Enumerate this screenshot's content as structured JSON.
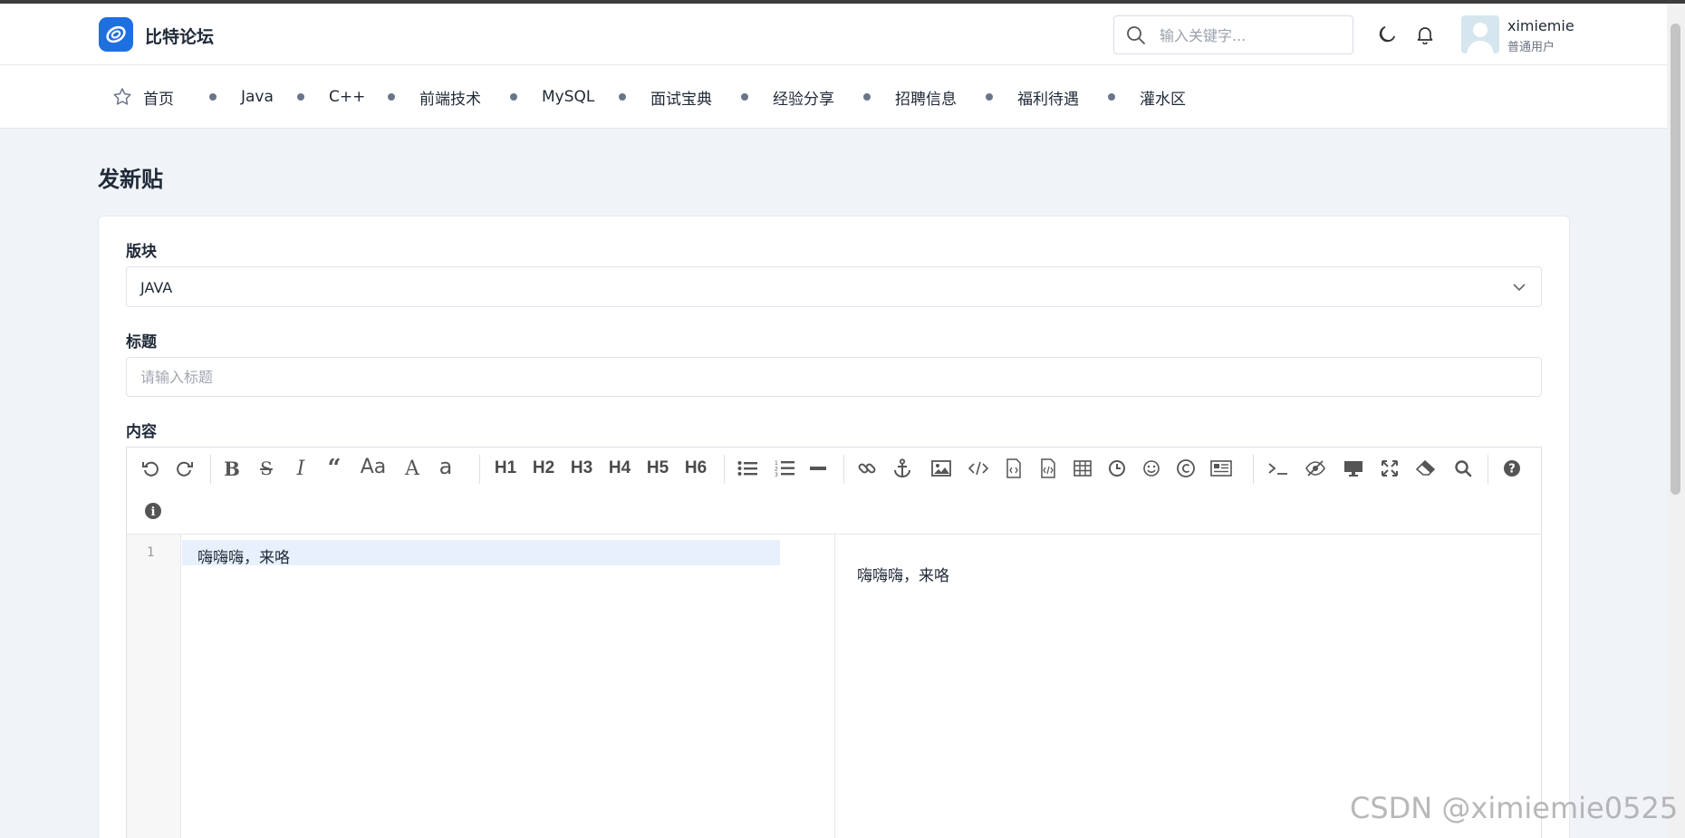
{
  "header": {
    "brand": "比特论坛",
    "search_placeholder": "输入关键字...",
    "user_name": "ximiemie",
    "user_role": "普通用户"
  },
  "nav": {
    "items": [
      {
        "label": "首页",
        "icon": "star-icon"
      },
      {
        "label": "Java"
      },
      {
        "label": "C++"
      },
      {
        "label": "前端技术"
      },
      {
        "label": "MySQL"
      },
      {
        "label": "面试宝典"
      },
      {
        "label": "经验分享"
      },
      {
        "label": "招聘信息"
      },
      {
        "label": "福利待遇"
      },
      {
        "label": "灌水区"
      }
    ]
  },
  "page": {
    "title": "发新贴"
  },
  "form": {
    "section_label": "版块",
    "section_value": "JAVA",
    "title_label": "标题",
    "title_placeholder": "请输入标题",
    "content_label": "内容"
  },
  "editor": {
    "headings": [
      "H1",
      "H2",
      "H3",
      "H4",
      "H5",
      "H6"
    ],
    "line_number": "1",
    "content": "嗨嗨嗨，来咯",
    "preview": "嗨嗨嗨，来咯",
    "toolbar_icons": [
      "undo-icon",
      "redo-icon",
      "bold-icon",
      "strikethrough-icon",
      "italic-icon",
      "quote-icon",
      "uppercase-icon",
      "upper-first-icon",
      "lowercase-icon",
      "h1-icon",
      "h2-icon",
      "h3-icon",
      "h4-icon",
      "h5-icon",
      "h6-icon",
      "unordered-list-icon",
      "ordered-list-icon",
      "horizontal-rule-icon",
      "link-icon",
      "anchor-icon",
      "image-icon",
      "code-icon",
      "code-block-icon",
      "html-entities-icon",
      "table-icon",
      "datetime-icon",
      "emoji-icon",
      "copyright-icon",
      "pagebreak-icon",
      "terminal-icon",
      "watch-icon",
      "preview-icon",
      "fullscreen-icon",
      "clear-icon",
      "search-icon",
      "help-icon",
      "info-icon"
    ]
  },
  "watermark": "CSDN @ximiemie0525",
  "colors": {
    "brand": "#1e6fe0",
    "page_bg": "#f0f3f8",
    "active_line": "#e8f0fc"
  }
}
